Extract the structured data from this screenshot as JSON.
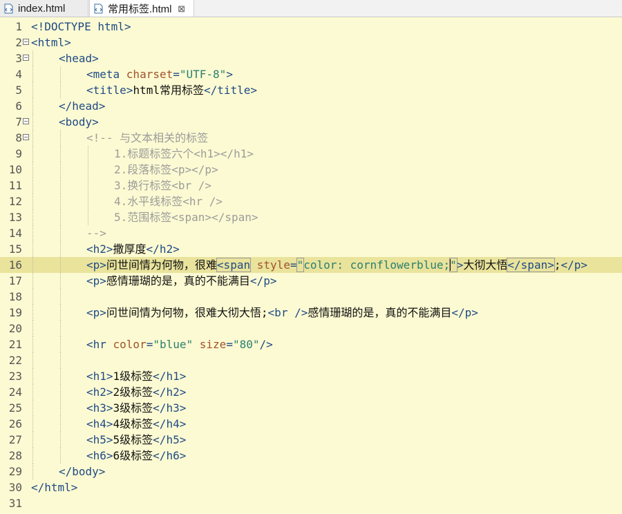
{
  "tabs": [
    {
      "label": "index.html"
    },
    {
      "label": "常用标签.html",
      "close": "⊠"
    }
  ],
  "lines": [
    {
      "n": "1",
      "tokens": [
        {
          "t": "<!DOCTYPE html>",
          "c": "tag"
        }
      ]
    },
    {
      "n": "2",
      "fold": true,
      "tokens": [
        {
          "t": "<html>",
          "c": "tag"
        }
      ]
    },
    {
      "n": "3",
      "fold": true,
      "indent": 1,
      "tokens": [
        {
          "t": "<head>",
          "c": "tag"
        }
      ]
    },
    {
      "n": "4",
      "indent": 2,
      "tokens": [
        {
          "t": "<meta ",
          "c": "tag"
        },
        {
          "t": "charset",
          "c": "attr"
        },
        {
          "t": "=",
          "c": "tag"
        },
        {
          "t": "\"UTF-8\"",
          "c": "str"
        },
        {
          "t": ">",
          "c": "tag"
        }
      ]
    },
    {
      "n": "5",
      "indent": 2,
      "tokens": [
        {
          "t": "<title>",
          "c": "tag"
        },
        {
          "t": "html常用标签",
          "c": "txt"
        },
        {
          "t": "</title>",
          "c": "tag"
        }
      ]
    },
    {
      "n": "6",
      "indent": 1,
      "tokens": [
        {
          "t": "</head>",
          "c": "tag"
        }
      ]
    },
    {
      "n": "7",
      "fold": true,
      "indent": 1,
      "tokens": [
        {
          "t": "<body>",
          "c": "tag"
        }
      ]
    },
    {
      "n": "8",
      "fold": true,
      "indent": 2,
      "tokens": [
        {
          "t": "<!-- 与文本相关的标签",
          "c": "cmt"
        }
      ]
    },
    {
      "n": "9",
      "indent": 3,
      "tokens": [
        {
          "t": "1.标题标签六个<h1></h1>",
          "c": "cmt"
        }
      ]
    },
    {
      "n": "10",
      "indent": 3,
      "tokens": [
        {
          "t": "2.段落标签<p></p>",
          "c": "cmt"
        }
      ]
    },
    {
      "n": "11",
      "indent": 3,
      "tokens": [
        {
          "t": "3.换行标签<br />",
          "c": "cmt"
        }
      ]
    },
    {
      "n": "12",
      "indent": 3,
      "tokens": [
        {
          "t": "4.水平线标签<hr />",
          "c": "cmt"
        }
      ]
    },
    {
      "n": "13",
      "indent": 3,
      "tokens": [
        {
          "t": "5.范围标签<span></span>",
          "c": "cmt"
        }
      ]
    },
    {
      "n": "14",
      "indent": 2,
      "tokens": [
        {
          "t": "-->",
          "c": "cmt"
        }
      ]
    },
    {
      "n": "15",
      "indent": 2,
      "tokens": [
        {
          "t": "<h2>",
          "c": "tag"
        },
        {
          "t": "撒厚度",
          "c": "txt"
        },
        {
          "t": "</h2>",
          "c": "tag"
        }
      ]
    },
    {
      "n": "16",
      "current": true,
      "indent": 2,
      "tokens": [
        {
          "t": "<p>",
          "c": "tag"
        },
        {
          "t": "问世间情为何物，很难",
          "c": "txt"
        },
        {
          "t": "<span",
          "c": "tag box"
        },
        {
          "t": " ",
          "c": "txt"
        },
        {
          "t": "style",
          "c": "attr"
        },
        {
          "t": "=",
          "c": "tag"
        },
        {
          "t": "\"",
          "c": "str box"
        },
        {
          "t": "color: cornflowerblue;",
          "c": "str"
        },
        {
          "t": "\"",
          "c": "str box caretafter"
        },
        {
          "t": ">",
          "c": "tag"
        },
        {
          "t": "大彻大悟",
          "c": "txt"
        },
        {
          "t": "</span>",
          "c": "tag box"
        },
        {
          "t": ";",
          "c": "txt"
        },
        {
          "t": "</p>",
          "c": "tag"
        }
      ]
    },
    {
      "n": "17",
      "indent": 2,
      "tokens": [
        {
          "t": "<p>",
          "c": "tag"
        },
        {
          "t": "感情珊瑚的是，真的不能满目",
          "c": "txt"
        },
        {
          "t": "</p>",
          "c": "tag"
        }
      ]
    },
    {
      "n": "18",
      "indent": 2,
      "tokens": []
    },
    {
      "n": "19",
      "indent": 2,
      "tokens": [
        {
          "t": "<p>",
          "c": "tag"
        },
        {
          "t": "问世间情为何物，很难大彻大悟;",
          "c": "txt"
        },
        {
          "t": "<br />",
          "c": "tag"
        },
        {
          "t": "感情珊瑚的是，真的不能满目",
          "c": "txt"
        },
        {
          "t": "</p>",
          "c": "tag"
        }
      ]
    },
    {
      "n": "20",
      "indent": 2,
      "tokens": []
    },
    {
      "n": "21",
      "indent": 2,
      "tokens": [
        {
          "t": "<hr ",
          "c": "tag"
        },
        {
          "t": "color",
          "c": "attr"
        },
        {
          "t": "=",
          "c": "tag"
        },
        {
          "t": "\"blue\"",
          "c": "str"
        },
        {
          "t": " ",
          "c": "txt"
        },
        {
          "t": "size",
          "c": "attr"
        },
        {
          "t": "=",
          "c": "tag"
        },
        {
          "t": "\"80\"",
          "c": "str"
        },
        {
          "t": "/>",
          "c": "tag"
        }
      ]
    },
    {
      "n": "22",
      "indent": 2,
      "tokens": []
    },
    {
      "n": "23",
      "indent": 2,
      "tokens": [
        {
          "t": "<h1>",
          "c": "tag"
        },
        {
          "t": "1级标签",
          "c": "txt"
        },
        {
          "t": "</h1>",
          "c": "tag"
        }
      ]
    },
    {
      "n": "24",
      "indent": 2,
      "tokens": [
        {
          "t": "<h2>",
          "c": "tag"
        },
        {
          "t": "2级标签",
          "c": "txt"
        },
        {
          "t": "</h2>",
          "c": "tag"
        }
      ]
    },
    {
      "n": "25",
      "indent": 2,
      "tokens": [
        {
          "t": "<h3>",
          "c": "tag"
        },
        {
          "t": "3级标签",
          "c": "txt"
        },
        {
          "t": "</h3>",
          "c": "tag"
        }
      ]
    },
    {
      "n": "26",
      "indent": 2,
      "tokens": [
        {
          "t": "<h4>",
          "c": "tag"
        },
        {
          "t": "4级标签",
          "c": "txt"
        },
        {
          "t": "</h4>",
          "c": "tag"
        }
      ]
    },
    {
      "n": "27",
      "indent": 2,
      "tokens": [
        {
          "t": "<h5>",
          "c": "tag"
        },
        {
          "t": "5级标签",
          "c": "txt"
        },
        {
          "t": "</h5>",
          "c": "tag"
        }
      ]
    },
    {
      "n": "28",
      "indent": 2,
      "tokens": [
        {
          "t": "<h6>",
          "c": "tag"
        },
        {
          "t": "6级标签",
          "c": "txt"
        },
        {
          "t": "</h6>",
          "c": "tag"
        }
      ]
    },
    {
      "n": "29",
      "indent": 1,
      "tokens": [
        {
          "t": "</body>",
          "c": "tag"
        }
      ]
    },
    {
      "n": "30",
      "tokens": [
        {
          "t": "</html>",
          "c": "tag"
        }
      ]
    },
    {
      "n": "31",
      "tokens": []
    }
  ]
}
